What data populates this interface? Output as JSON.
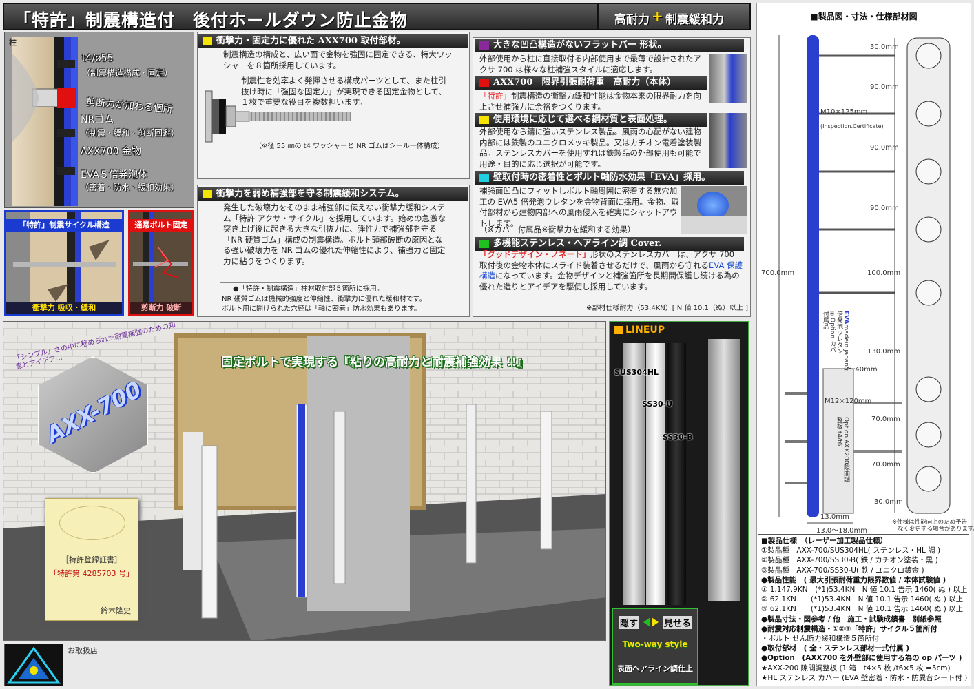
{
  "header": {
    "title": "「特許」制震構造付　後付ホールダウン防止金物",
    "right_a": "高耐力",
    "plus": "+",
    "right_b": "制震緩和力"
  },
  "cross_section": {
    "pillar": "柱",
    "l1": "t4/ø55",
    "l1s": "（制震構造構成 · 固定）",
    "l2": "剪断力が加わる個所",
    "l3": "NRゴム",
    "l3s": "（制震 · 緩和 · 剪断回避）",
    "l4": "AXX700 金物",
    "l5": "EVA５倍発泡体",
    "l5s": "（密着 · 防水 · 緩和効果）"
  },
  "photo_left": {
    "top": "「特許」制震サイクル構造",
    "bottom": "衝撃力 吸収 · 緩和"
  },
  "photo_right": {
    "top": "通常ボルト固定",
    "bottom": "剪断力 破断"
  },
  "sec1": {
    "title": "衝撃力・固定力に優れた AXX700 取付部材。",
    "p1": "制震構造の構成と、広い面で金物を強固に固定できる、特大ワッシャーを８箇所採用しています。",
    "p2": "制震性を効率よく発揮させる構成パーツとして、また柱引抜け時に「強固な固定力」が実現できる固定金物として、１枚で重要な役目を複数担います。",
    "note": "（※径 55 ㎜の t4 ワッシャーと NR ゴムはシール一体構成）"
  },
  "sec2": {
    "title": "衝撃力を弱め補強部を守る制震緩和システム。",
    "p": "発生した破壊力をそのまま補強部に伝えない衝撃力緩和システム「特許 アクサ・サイクル」を採用しています。始めの急激な突き上げ後に起きる大きな引抜力に、弾性力で補強部を守る「NR 硬質ゴム」構成の制震構造。ボルト頭部破断の原因となる強い破壊力を NR ゴムの優れた伸縮性により、補強力と固定力に粘りをつくります。",
    "n1": "●「特許・制震構造」柱材取付部５箇所に採用。",
    "n2": "NR 硬質ゴムは機械的強度と伸縮性、衝撃力に優れた緩和材です。",
    "n3": "ボルト用に開けられた穴径は「軸に密着」防水効果もあります。"
  },
  "sec3": {
    "title": "大きな凹凸構造がないフラットバー 形状。",
    "p": "外部使用から柱に直接取付る内部使用まで最薄で設計されたアクサ 700 は様々な柱補強スタイルに適応します。"
  },
  "sec4": {
    "title": "AXX700　限界引張耐荷重　高耐力（本体）",
    "hl": "「特許」",
    "p": "制震構造の衝撃力緩和性能は金物本来の限界耐力を向上させ補強力に余裕をつくります。"
  },
  "sec5": {
    "title": "使用環境に応じて選べる鋼材質と表面処理。",
    "p": "外部使用なら錆に強いステンレス製品。風雨の心配がない建物内部には鉄製のユニクロメッキ製品。又はカチオン電着塗装製品。ステンレスカバーを使用すれば鉄製品の外部使用も可能で用途・目的に応じ選択が可能です。"
  },
  "sec6": {
    "title": "壁取付時の密着性とボルト軸防水効果「EVA」採用。",
    "p": "補強面凹凸にフィットしボルト軸周囲に密着する無穴加工の EVA5 倍発泡ウレタンを金物背面に採用。金物、取付部材から建物内部への風雨侵入を確実にシャットアウトします。",
    "note": "（※カバー付属品※衝撃力を緩和する効果）"
  },
  "sec7": {
    "title": "多機能ステンレス・ヘアライン調 Cover.",
    "hl": "「グッドデザイン・ノネート」",
    "p1": "形状のステンレスカバーは、アクサ 700 取付後の金物本体にスライド装着させるだけで、風雨から守れる",
    "hl2": "EVA 保護構造",
    "p2": "になっています。金物デザインと補強箇所を長期間保護し続ける為の優れた造りとアイデアを駆使し採用しています。",
    "foot": "※部材仕様耐力（53.4KN）[ N 値 10.1（ぬ）以上 ]"
  },
  "scene": {
    "headline": "固定ボルトで実現する『粘りの高耐力と耐震補強効果 !!』",
    "badge": "AXX-700",
    "arc_text": "「シンプル」さの中に秘められた耐震補強のための知恵とアイデア…",
    "cert_title": "［特許登録証書］",
    "cert_no": "「特許第 4285703 号」",
    "cert_sign": "鈴木隆史"
  },
  "lineup": {
    "title": "LINEUP",
    "m1": "SUS304HL",
    "m2": "SS30-U",
    "m3": "SS30-B",
    "hide": "隠す",
    "show": "見せる",
    "style": "Two-way style",
    "finish": "表面ヘアライン調仕上"
  },
  "footer": {
    "dealer": "お取扱店"
  },
  "spec": {
    "heading": "■製品図・寸法・仕様部材図",
    "d30a": "30.0mm",
    "d90a": "90.0mm",
    "d90b": "90.0mm",
    "d90c": "90.0mm",
    "d100": "100.0mm",
    "d130": "130.0mm",
    "d70a": "70.0mm",
    "d70b": "70.0mm",
    "d30b": "30.0mm",
    "d700": "700.0mm",
    "bolt1": "M10×125mm",
    "bolt1s": "(Inspection.Certificate)",
    "bolt2": "M12×120mm",
    "gap": "0～40mm",
    "w1": "13.0mm",
    "w2": "13.0～18.0mm",
    "eva1": "EVA",
    "eva2": "5 倍発泡ウレタン",
    "eva3": "madein.japan",
    "eva4": "※Option カバー付属品",
    "opt1": "Option AXX200",
    "opt2": "隙間調整板 t4/t6",
    "note1": "※仕様は性能向上のため予告",
    "note2": "なく変更する場合があります。",
    "lines": [
      "■製品仕様　（レーザー加工製品仕様）",
      "①製品種　AXX-700/SUS304HL( ステンレス・HL 調 )",
      "②製品種　AXX-700/SS30-B( 鉄 / カチオン塗装・黒 )",
      "③製品種　AXX-700/SS30-U( 鉄 / ユニクロ鍍金 )",
      "●製品性能　( 最大引張耐荷重力限界数値 / 本体試験値 )",
      "① 1.147.9KN　(*1)53.4KN　N 値 10.1 告示 1460( ぬ ) 以上",
      "② 62.1KN　　(*1)53.4KN　N 値 10.1 告示 1460( ぬ ) 以上",
      "③ 62.1KN　　(*1)53.4KN　N 値 10.1 告示 1460( ぬ ) 以上",
      "●製品寸法・図参考 / 他　施工・試験成績書　別紙参照",
      "●耐震対応制震構造・①②③「特許」サイクル５箇所付",
      "・ボルト せん断力緩和構造５箇所付",
      "●取付部材　( 全・ステンレス部材一式付属 )",
      "●Option　(AXX700 を外壁部に使用する為の op パーツ )",
      "★AXX-200 隙間調整板 (1 箱　t4×5 枚 /t6×5 枚 =5cm)",
      "★HL ステンレス カバー (EVA 壁密着・防水・防異音シート付 )"
    ]
  },
  "colors": {
    "accent_yellow": "#f5e400",
    "accent_purple": "#8a2a9a",
    "accent_red": "#e01010",
    "accent_cyan": "#20d0e0",
    "accent_green": "#20c020",
    "highlight_red": "#e03030",
    "highlight_blue": "#1a4ad0",
    "plate_blue": "#2a3fcf"
  }
}
